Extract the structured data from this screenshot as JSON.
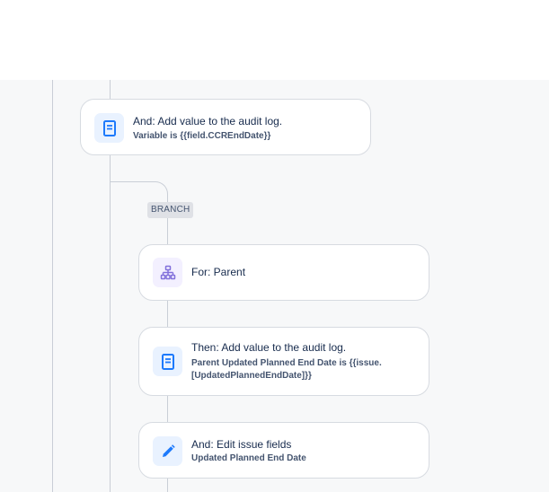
{
  "flow": {
    "audit_log_step": {
      "title": "And: Add value to the audit log.",
      "detail": "Variable is {{field.CCREndDate}}",
      "icon": "document-icon"
    },
    "branch": {
      "label": "BRANCH",
      "for_step": {
        "title": "For: Parent",
        "icon": "hierarchy-icon"
      },
      "then_step": {
        "title": "Then: Add value to the audit log.",
        "detail_line1": "Parent Updated Planned End Date is {{issue.",
        "detail_line2": "[UpdatedPlannedEndDate]}}",
        "icon": "document-icon"
      },
      "edit_step": {
        "title": "And: Edit issue fields",
        "detail": "Updated Planned End Date",
        "icon": "pencil-icon"
      }
    }
  },
  "colors": {
    "canvas": "#f7f8f9",
    "connector": "#c9ced6",
    "accent_blue": "#1d7afc",
    "accent_purple": "#8270db"
  }
}
